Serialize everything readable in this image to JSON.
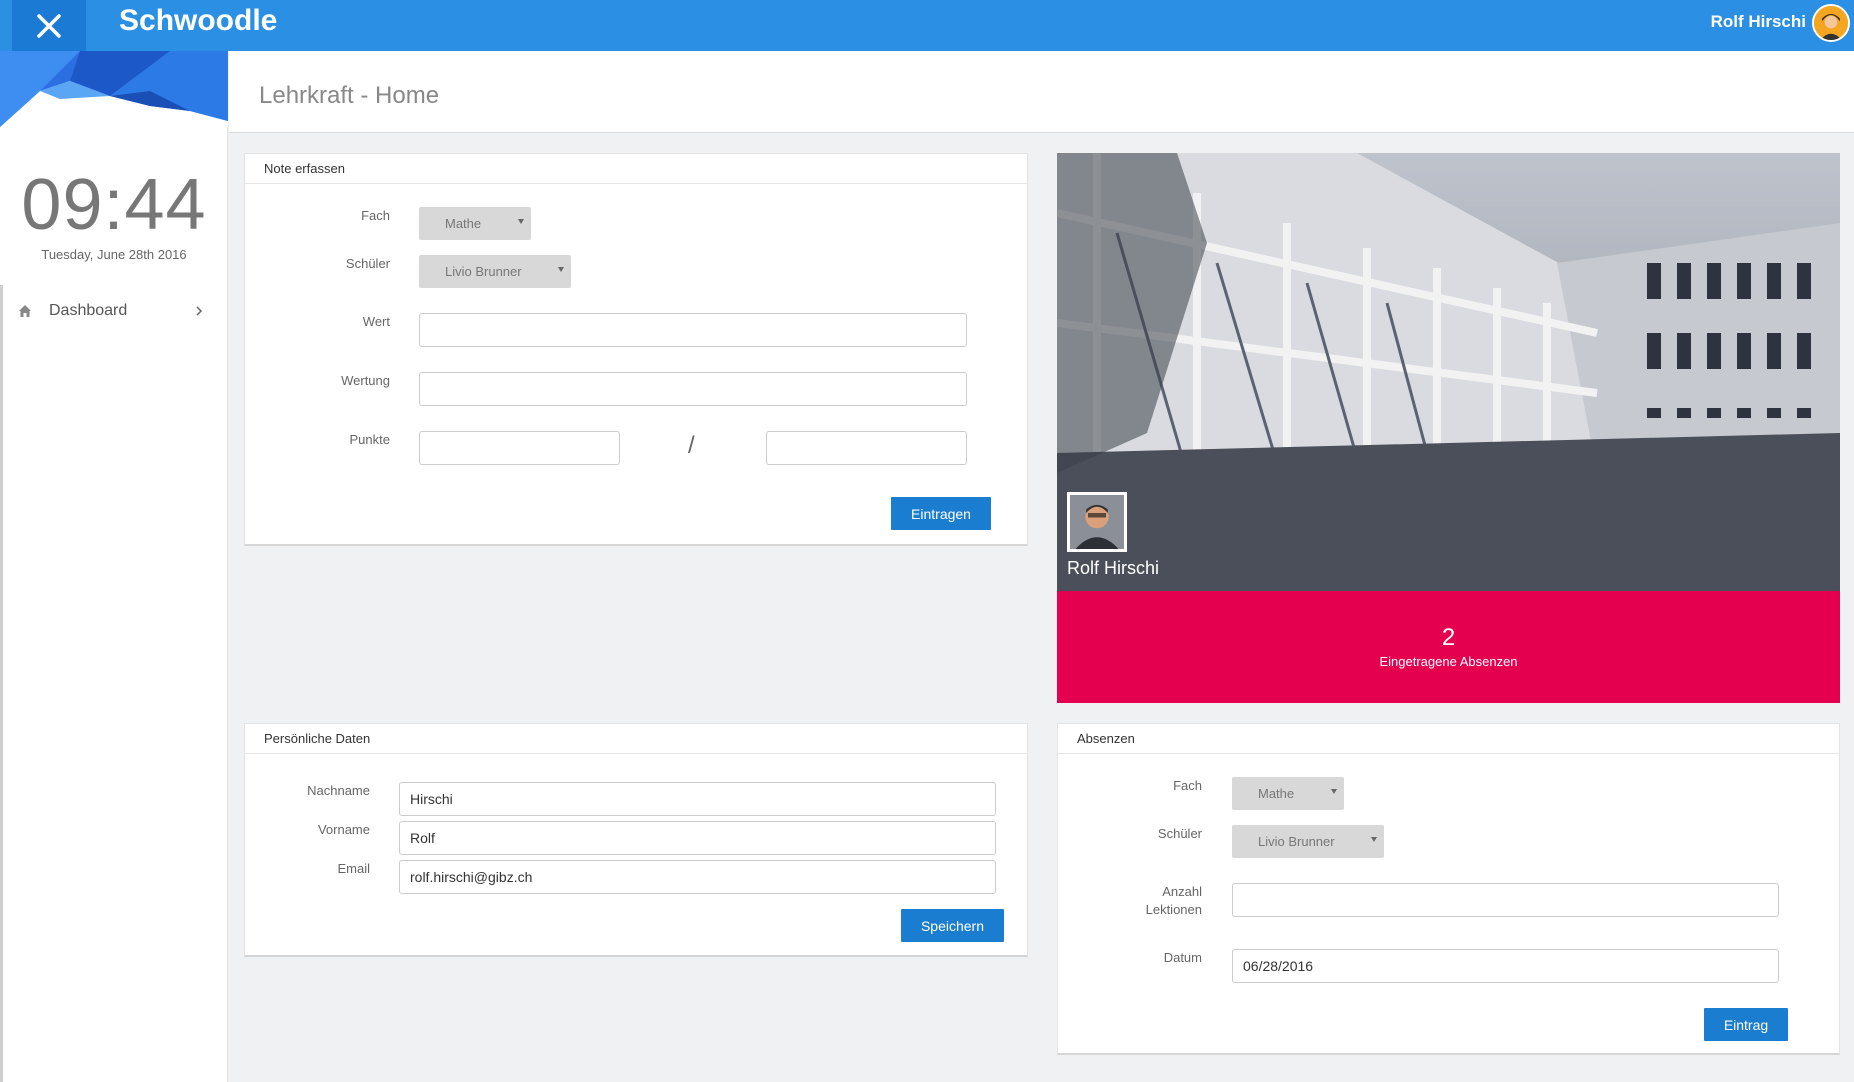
{
  "app": {
    "title": "Schwoodle",
    "close_icon": "close-icon"
  },
  "user": {
    "name": "Rolf Hirschi"
  },
  "sidebar": {
    "clock": "09:44",
    "date": "Tuesday, June 28th 2016",
    "items": [
      {
        "label": "Dashboard",
        "icon": "home-icon"
      }
    ]
  },
  "page": {
    "title": "Lehrkraft - Home"
  },
  "grade_panel": {
    "title": "Note erfassen",
    "labels": {
      "subject": "Fach",
      "student": "Schüler",
      "value": "Wert",
      "weight": "Wertung",
      "points": "Punkte"
    },
    "subject_selected": "Mathe",
    "student_selected": "Livio Brunner",
    "value": "",
    "weight": "",
    "points_achieved": "",
    "points_max": "",
    "points_separator": "/",
    "submit_label": "Eintragen"
  },
  "profile": {
    "name": "Rolf Hirschi",
    "absence_count": "2",
    "absence_label": "Eingetragene Absenzen"
  },
  "personal_panel": {
    "title": "Persönliche Daten",
    "labels": {
      "lastname": "Nachname",
      "firstname": "Vorname",
      "email": "Email"
    },
    "lastname": "Hirschi",
    "firstname": "Rolf",
    "email": "rolf.hirschi@gibz.ch",
    "save_label": "Speichern"
  },
  "absence_panel": {
    "title": "Absenzen",
    "labels": {
      "subject": "Fach",
      "student": "Schüler",
      "lessons_line1": "Anzahl",
      "lessons_line2": "Lektionen",
      "date": "Datum"
    },
    "subject_selected": "Mathe",
    "student_selected": "Livio Brunner",
    "lessons": "",
    "date": "06/28/2016",
    "submit_label": "Eintrag"
  },
  "colors": {
    "topbar": "#2b8fe3",
    "accent": "#1a7dd0",
    "absence_card": "#e4004f"
  }
}
